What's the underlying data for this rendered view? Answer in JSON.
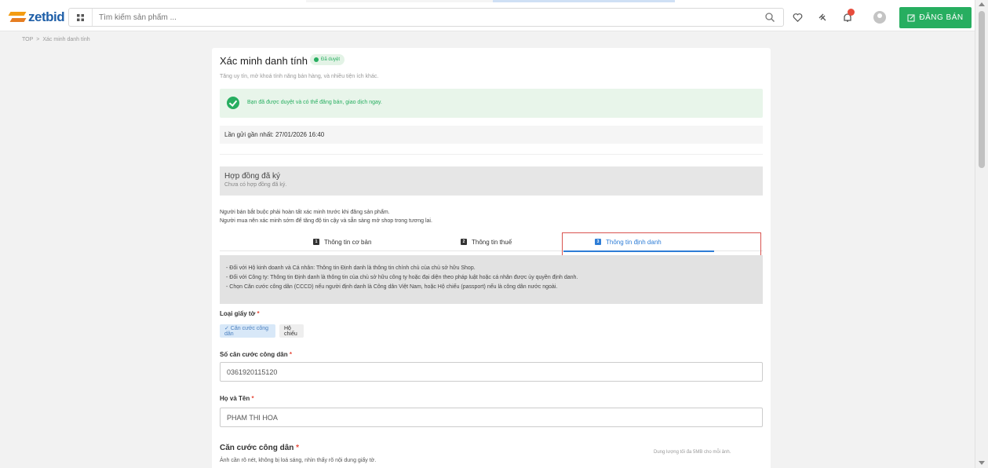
{
  "app": {
    "logo_text": "zetbid"
  },
  "search": {
    "placeholder": "Tìm kiếm sản phẩm ..."
  },
  "header": {
    "sell_button": "ĐĂNG BÁN"
  },
  "breadcrumb": {
    "home": "TOP",
    "separator": ">",
    "current": "Xác minh danh tính"
  },
  "page": {
    "title": "Xác minh danh tính",
    "status_badge": "Đã duyệt",
    "subtitle": "Tăng uy tín, mở khoá tính năng bán hàng, và nhiều tiện ích khác."
  },
  "success_message": "Bạn đã được duyệt và có thể đăng bán, giao dịch ngay.",
  "last_sent": "Lần gửi gần nhất: 27/01/2026 16:40",
  "contract": {
    "title": "Hợp đồng đã ký",
    "subtitle": "Chưa có hợp đồng đã ký."
  },
  "notes": [
    "Người bán bắt buộc phải hoàn tất xác minh trước khi đăng sản phẩm.",
    "Người mua nên xác minh sớm để tăng độ tin cậy và sẵn sàng mở shop trong tương lai."
  ],
  "tabs": [
    {
      "num": "1",
      "label": "Thông tin cơ bản"
    },
    {
      "num": "2",
      "label": "Thông tin thuế"
    },
    {
      "num": "3",
      "label": "Thông tin định danh"
    }
  ],
  "info_lines": [
    "- Đối với Hộ kinh doanh và Cá nhân: Thông tin Định danh là thông tin chính chủ của chủ sở hữu Shop.",
    "- Đối với Công ty: Thông tin Định danh là thông tin của chủ sở hữu công ty hoặc đại diện theo pháp luật hoặc cá nhân được ủy quyền định danh.",
    "- Chọn Căn cước công dân (CCCD) nếu người định danh là Công dân Việt Nam, hoặc Hộ chiếu (passport) nếu là công dân nước ngoài."
  ],
  "doc_type": {
    "label": "Loại giấy tờ",
    "options": [
      "✓ Căn cước công dân",
      "Hộ chiếu"
    ]
  },
  "id_number": {
    "label": "Số căn cước công dân",
    "value": "0361920115120"
  },
  "full_name": {
    "label": "Họ và Tên",
    "value": "PHAM THI HOA"
  },
  "id_docs": {
    "title": "Căn cước công dân",
    "hint": "Ảnh cần rõ nét, không bị loá sáng, nhìn thấy rõ nội dung giấy tờ.",
    "limit": "Dung lượng tối đa 5MB cho mỗi ảnh."
  }
}
